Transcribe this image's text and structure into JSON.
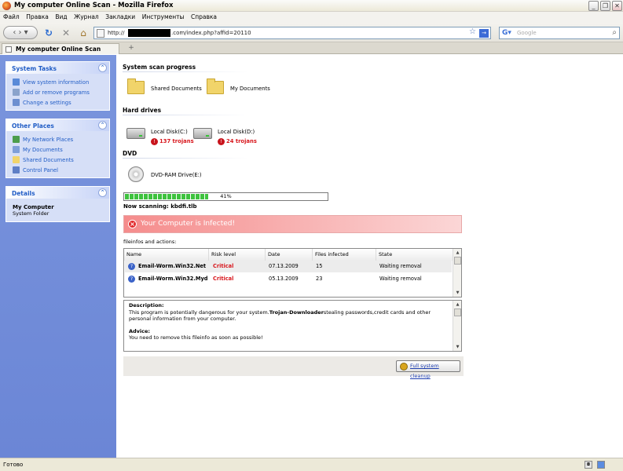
{
  "window": {
    "title": "My computer Online Scan - Mozilla Firefox"
  },
  "menu": [
    "Файл",
    "Правка",
    "Вид",
    "Журнал",
    "Закладки",
    "Инструменты",
    "Справка"
  ],
  "nav": {
    "url_prefix": "http://",
    "url_suffix": ".com/index.php?affid=20110",
    "search_placeholder": "Google"
  },
  "tab": {
    "label": "My computer Online Scan"
  },
  "sidebar": {
    "system_tasks": {
      "title": "System Tasks",
      "items": [
        "View system information",
        "Add or remove programs",
        "Change a settings"
      ]
    },
    "other_places": {
      "title": "Other Places",
      "items": [
        "My Network Places",
        "My Documents",
        "Shared Documents",
        "Control Panel"
      ]
    },
    "details": {
      "title": "Details",
      "name": "My Computer",
      "type": "System Folder"
    }
  },
  "main": {
    "progress_header": "System scan progress",
    "folders": [
      "Shared Documents",
      "My Documents"
    ],
    "hard_drives_header": "Hard drives",
    "drives": [
      {
        "name": "Local Disk(C:)",
        "trojans": "137 trojans"
      },
      {
        "name": "Local Disk(D:)",
        "trojans": "24 trojans"
      }
    ],
    "dvd_header": "DVD",
    "dvd_drive": "DVD-RAM Drive(E:)",
    "progress": {
      "percent_label": "41%",
      "value": 0.41
    },
    "now_scanning": "Now scanning: kbdfi.tlb",
    "alert": "Your Computer is Infected!",
    "fileinfos_label": "fileinfos and actions:",
    "table": {
      "columns": [
        "Name",
        "Risk level",
        "Date",
        "Files infected",
        "State"
      ],
      "rows": [
        {
          "name": "Email-Worm.Win32.Net",
          "risk": "Critical",
          "date": "07.13.2009",
          "files": "15",
          "state": "Waiting removal"
        },
        {
          "name": "Email-Worm.Win32.Myd",
          "risk": "Critical",
          "date": "05.13.2009",
          "files": "23",
          "state": "Waiting removal"
        }
      ]
    },
    "description": {
      "title": "Description:",
      "text_1": "This program is potentially dangerous for your system.",
      "bold": "Trojan-Downloader",
      "text_2": "stealing passwords,credit cards and other",
      "text_3": "personal information from your computer.",
      "advice_title": "Advice:",
      "advice_text": "You need to remove this fileinfo as soon as possible!"
    },
    "cleanup_button": "Full system cleanup"
  },
  "status": {
    "text": "Готово"
  },
  "colors": {
    "critical": "#d8161c",
    "sidebar": "#6b86d6",
    "alert": "#f58c8c",
    "link": "#215dc6"
  }
}
